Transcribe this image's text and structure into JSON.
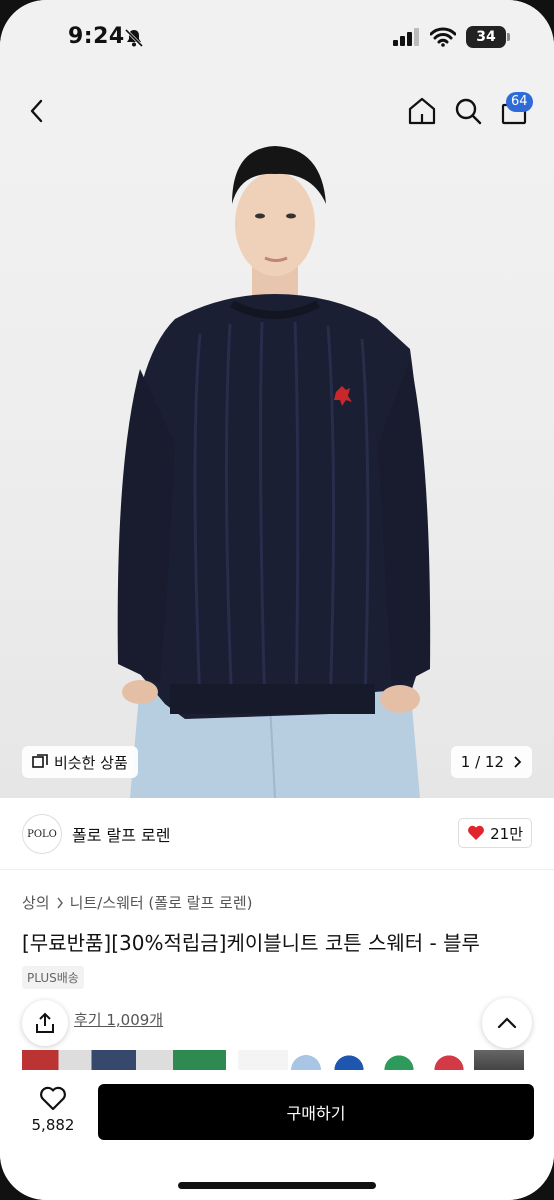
{
  "status_bar": {
    "time": "9:24",
    "battery": "34"
  },
  "header": {
    "cart_count": "64"
  },
  "hero": {
    "similar_label": "비슷한 상품",
    "page_indicator": "1 / 12"
  },
  "brand": {
    "logo_text": "POLO",
    "name": "폴로 랄프 로렌",
    "likes": "21만"
  },
  "breadcrumb": {
    "level1": "상의",
    "level2": "니트/스웨터 (폴로 랄프 로렌)"
  },
  "product": {
    "title": "[무료반품][30%적립금]케이블니트 코튼 스웨터 - 블루",
    "shipping_badge": "PLUS배송",
    "review_link": "후기 1,009개"
  },
  "bottom_bar": {
    "heart_count": "5,882",
    "buy_label": "구매하기"
  },
  "colors": {
    "accent": "#2f6bd8",
    "like": "#e0252b",
    "sweater": "#1b1f33"
  }
}
